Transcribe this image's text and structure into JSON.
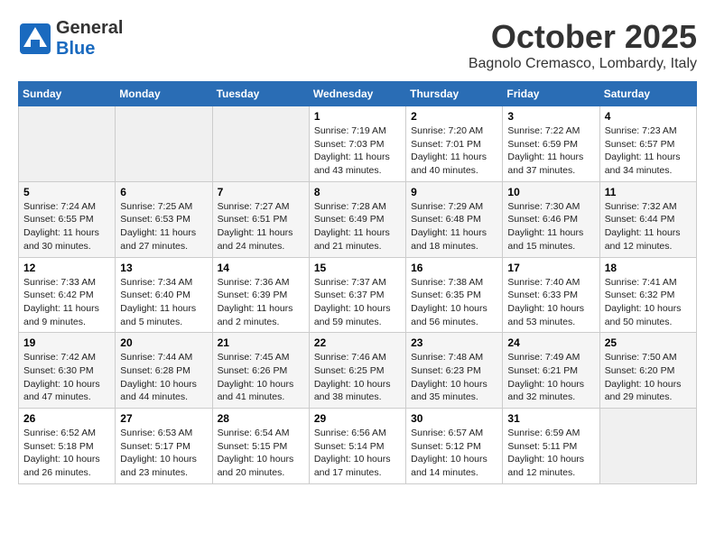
{
  "header": {
    "logo_general": "General",
    "logo_blue": "Blue",
    "month": "October 2025",
    "location": "Bagnolo Cremasco, Lombardy, Italy"
  },
  "weekdays": [
    "Sunday",
    "Monday",
    "Tuesday",
    "Wednesday",
    "Thursday",
    "Friday",
    "Saturday"
  ],
  "weeks": [
    [
      {
        "day": "",
        "sunrise": "",
        "sunset": "",
        "daylight": ""
      },
      {
        "day": "",
        "sunrise": "",
        "sunset": "",
        "daylight": ""
      },
      {
        "day": "",
        "sunrise": "",
        "sunset": "",
        "daylight": ""
      },
      {
        "day": "1",
        "sunrise": "Sunrise: 7:19 AM",
        "sunset": "Sunset: 7:03 PM",
        "daylight": "Daylight: 11 hours and 43 minutes."
      },
      {
        "day": "2",
        "sunrise": "Sunrise: 7:20 AM",
        "sunset": "Sunset: 7:01 PM",
        "daylight": "Daylight: 11 hours and 40 minutes."
      },
      {
        "day": "3",
        "sunrise": "Sunrise: 7:22 AM",
        "sunset": "Sunset: 6:59 PM",
        "daylight": "Daylight: 11 hours and 37 minutes."
      },
      {
        "day": "4",
        "sunrise": "Sunrise: 7:23 AM",
        "sunset": "Sunset: 6:57 PM",
        "daylight": "Daylight: 11 hours and 34 minutes."
      }
    ],
    [
      {
        "day": "5",
        "sunrise": "Sunrise: 7:24 AM",
        "sunset": "Sunset: 6:55 PM",
        "daylight": "Daylight: 11 hours and 30 minutes."
      },
      {
        "day": "6",
        "sunrise": "Sunrise: 7:25 AM",
        "sunset": "Sunset: 6:53 PM",
        "daylight": "Daylight: 11 hours and 27 minutes."
      },
      {
        "day": "7",
        "sunrise": "Sunrise: 7:27 AM",
        "sunset": "Sunset: 6:51 PM",
        "daylight": "Daylight: 11 hours and 24 minutes."
      },
      {
        "day": "8",
        "sunrise": "Sunrise: 7:28 AM",
        "sunset": "Sunset: 6:49 PM",
        "daylight": "Daylight: 11 hours and 21 minutes."
      },
      {
        "day": "9",
        "sunrise": "Sunrise: 7:29 AM",
        "sunset": "Sunset: 6:48 PM",
        "daylight": "Daylight: 11 hours and 18 minutes."
      },
      {
        "day": "10",
        "sunrise": "Sunrise: 7:30 AM",
        "sunset": "Sunset: 6:46 PM",
        "daylight": "Daylight: 11 hours and 15 minutes."
      },
      {
        "day": "11",
        "sunrise": "Sunrise: 7:32 AM",
        "sunset": "Sunset: 6:44 PM",
        "daylight": "Daylight: 11 hours and 12 minutes."
      }
    ],
    [
      {
        "day": "12",
        "sunrise": "Sunrise: 7:33 AM",
        "sunset": "Sunset: 6:42 PM",
        "daylight": "Daylight: 11 hours and 9 minutes."
      },
      {
        "day": "13",
        "sunrise": "Sunrise: 7:34 AM",
        "sunset": "Sunset: 6:40 PM",
        "daylight": "Daylight: 11 hours and 5 minutes."
      },
      {
        "day": "14",
        "sunrise": "Sunrise: 7:36 AM",
        "sunset": "Sunset: 6:39 PM",
        "daylight": "Daylight: 11 hours and 2 minutes."
      },
      {
        "day": "15",
        "sunrise": "Sunrise: 7:37 AM",
        "sunset": "Sunset: 6:37 PM",
        "daylight": "Daylight: 10 hours and 59 minutes."
      },
      {
        "day": "16",
        "sunrise": "Sunrise: 7:38 AM",
        "sunset": "Sunset: 6:35 PM",
        "daylight": "Daylight: 10 hours and 56 minutes."
      },
      {
        "day": "17",
        "sunrise": "Sunrise: 7:40 AM",
        "sunset": "Sunset: 6:33 PM",
        "daylight": "Daylight: 10 hours and 53 minutes."
      },
      {
        "day": "18",
        "sunrise": "Sunrise: 7:41 AM",
        "sunset": "Sunset: 6:32 PM",
        "daylight": "Daylight: 10 hours and 50 minutes."
      }
    ],
    [
      {
        "day": "19",
        "sunrise": "Sunrise: 7:42 AM",
        "sunset": "Sunset: 6:30 PM",
        "daylight": "Daylight: 10 hours and 47 minutes."
      },
      {
        "day": "20",
        "sunrise": "Sunrise: 7:44 AM",
        "sunset": "Sunset: 6:28 PM",
        "daylight": "Daylight: 10 hours and 44 minutes."
      },
      {
        "day": "21",
        "sunrise": "Sunrise: 7:45 AM",
        "sunset": "Sunset: 6:26 PM",
        "daylight": "Daylight: 10 hours and 41 minutes."
      },
      {
        "day": "22",
        "sunrise": "Sunrise: 7:46 AM",
        "sunset": "Sunset: 6:25 PM",
        "daylight": "Daylight: 10 hours and 38 minutes."
      },
      {
        "day": "23",
        "sunrise": "Sunrise: 7:48 AM",
        "sunset": "Sunset: 6:23 PM",
        "daylight": "Daylight: 10 hours and 35 minutes."
      },
      {
        "day": "24",
        "sunrise": "Sunrise: 7:49 AM",
        "sunset": "Sunset: 6:21 PM",
        "daylight": "Daylight: 10 hours and 32 minutes."
      },
      {
        "day": "25",
        "sunrise": "Sunrise: 7:50 AM",
        "sunset": "Sunset: 6:20 PM",
        "daylight": "Daylight: 10 hours and 29 minutes."
      }
    ],
    [
      {
        "day": "26",
        "sunrise": "Sunrise: 6:52 AM",
        "sunset": "Sunset: 5:18 PM",
        "daylight": "Daylight: 10 hours and 26 minutes."
      },
      {
        "day": "27",
        "sunrise": "Sunrise: 6:53 AM",
        "sunset": "Sunset: 5:17 PM",
        "daylight": "Daylight: 10 hours and 23 minutes."
      },
      {
        "day": "28",
        "sunrise": "Sunrise: 6:54 AM",
        "sunset": "Sunset: 5:15 PM",
        "daylight": "Daylight: 10 hours and 20 minutes."
      },
      {
        "day": "29",
        "sunrise": "Sunrise: 6:56 AM",
        "sunset": "Sunset: 5:14 PM",
        "daylight": "Daylight: 10 hours and 17 minutes."
      },
      {
        "day": "30",
        "sunrise": "Sunrise: 6:57 AM",
        "sunset": "Sunset: 5:12 PM",
        "daylight": "Daylight: 10 hours and 14 minutes."
      },
      {
        "day": "31",
        "sunrise": "Sunrise: 6:59 AM",
        "sunset": "Sunset: 5:11 PM",
        "daylight": "Daylight: 10 hours and 12 minutes."
      },
      {
        "day": "",
        "sunrise": "",
        "sunset": "",
        "daylight": ""
      }
    ]
  ]
}
